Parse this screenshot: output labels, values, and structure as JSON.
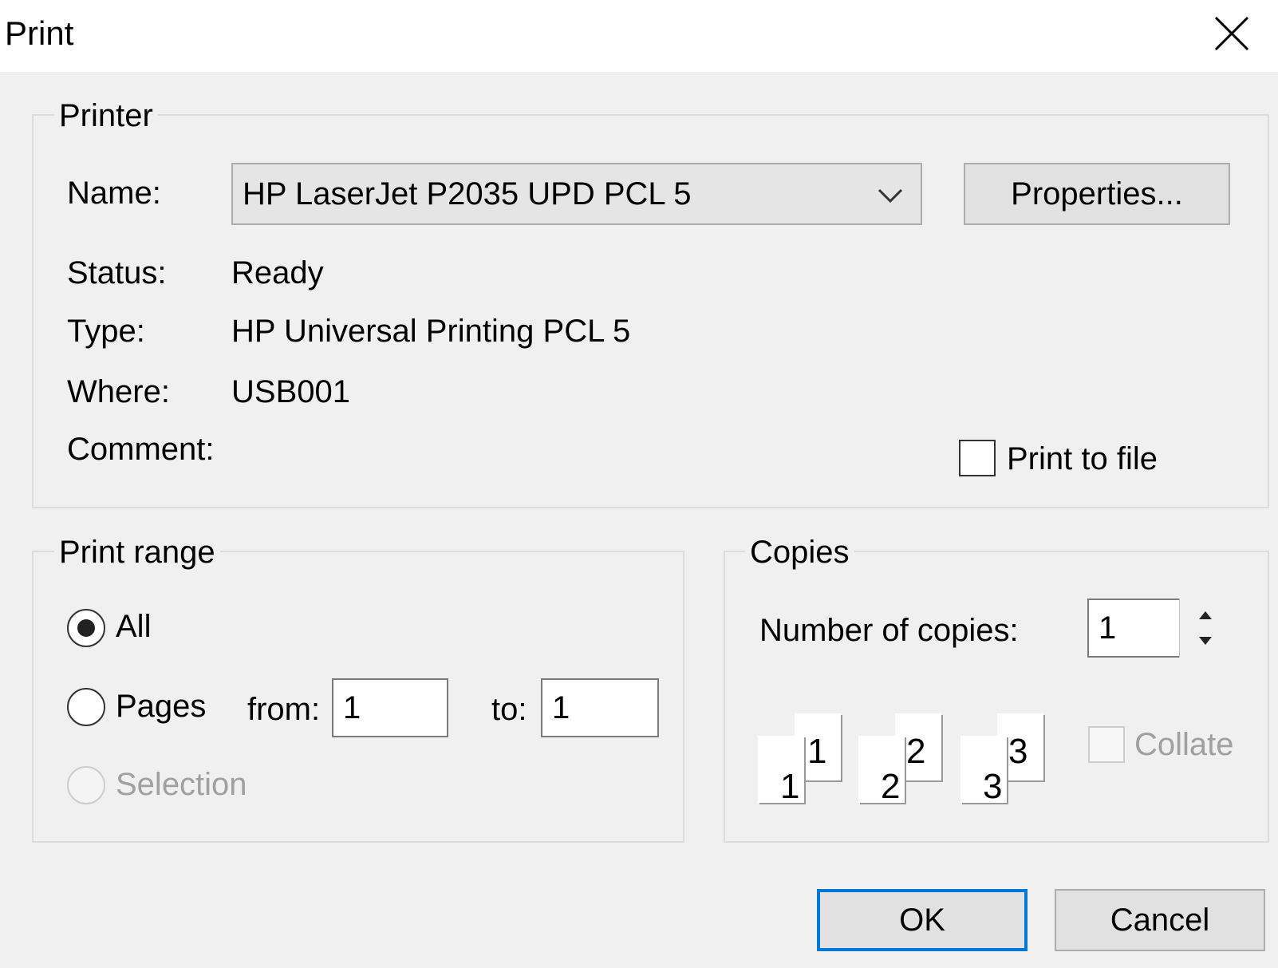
{
  "window": {
    "title": "Print"
  },
  "printer": {
    "legend": "Printer",
    "name_label": "Name:",
    "name_value": "HP LaserJet P2035 UPD PCL 5",
    "properties_label": "Properties...",
    "status_label": "Status:",
    "status_value": "Ready",
    "type_label": "Type:",
    "type_value": "HP Universal Printing PCL 5",
    "where_label": "Where:",
    "where_value": "USB001",
    "comment_label": "Comment:",
    "comment_value": "",
    "print_to_file_label": "Print to file",
    "print_to_file_checked": false
  },
  "print_range": {
    "legend": "Print range",
    "all_label": "All",
    "all_selected": true,
    "pages_label": "Pages",
    "from_label": "from:",
    "from_value": "1",
    "to_label": "to:",
    "to_value": "1",
    "selection_label": "Selection",
    "selection_enabled": false
  },
  "copies": {
    "legend": "Copies",
    "number_label": "Number of copies:",
    "number_value": "1",
    "collate_label": "Collate",
    "collate_enabled": false,
    "collate_icon_numbers": [
      "1",
      "1",
      "2",
      "2",
      "3",
      "3"
    ]
  },
  "buttons": {
    "ok": "OK",
    "cancel": "Cancel"
  },
  "colors": {
    "accent": "#0078d7",
    "dialog_bg": "#f0f0f0",
    "button_bg": "#e1e1e1"
  }
}
